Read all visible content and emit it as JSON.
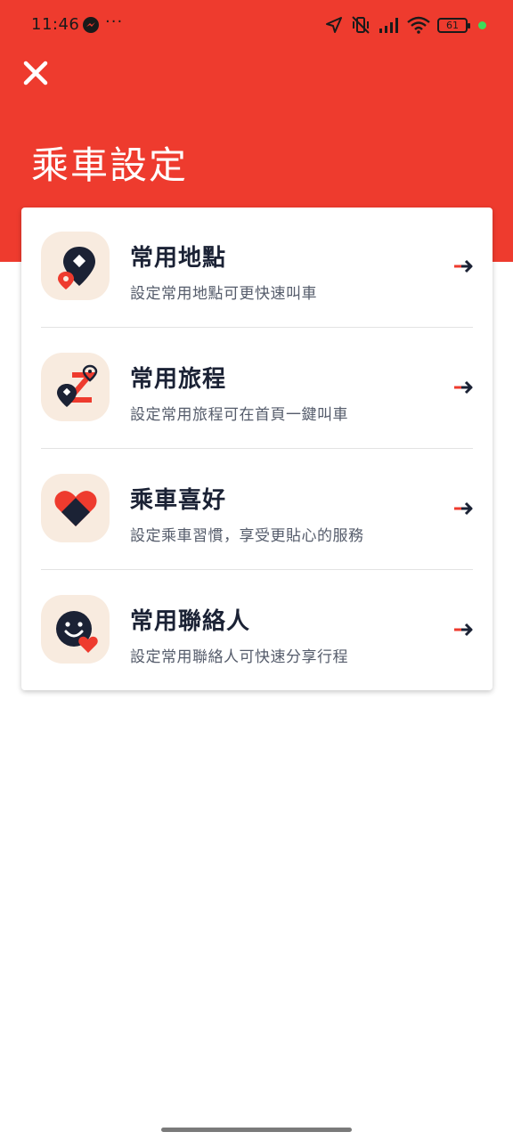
{
  "status_bar": {
    "time": "11:46",
    "dots": "···",
    "battery": "61"
  },
  "header": {
    "title": "乘車設定"
  },
  "colors": {
    "brand_red": "#ee3b2e",
    "navy": "#1b2235",
    "tile_bg": "#f8ebdf",
    "accent_red": "#ee3b2e"
  },
  "menu": {
    "items": [
      {
        "title": "常用地點",
        "subtitle": "設定常用地點可更快速叫車",
        "icon": "location-pin-icon"
      },
      {
        "title": "常用旅程",
        "subtitle": "設定常用旅程可在首頁一鍵叫車",
        "icon": "route-icon"
      },
      {
        "title": "乘車喜好",
        "subtitle": "設定乘車習慣，享受更貼心的服務",
        "icon": "heart-icon"
      },
      {
        "title": "常用聯絡人",
        "subtitle": "設定常用聯絡人可快速分享行程",
        "icon": "contact-smile-icon"
      }
    ]
  }
}
